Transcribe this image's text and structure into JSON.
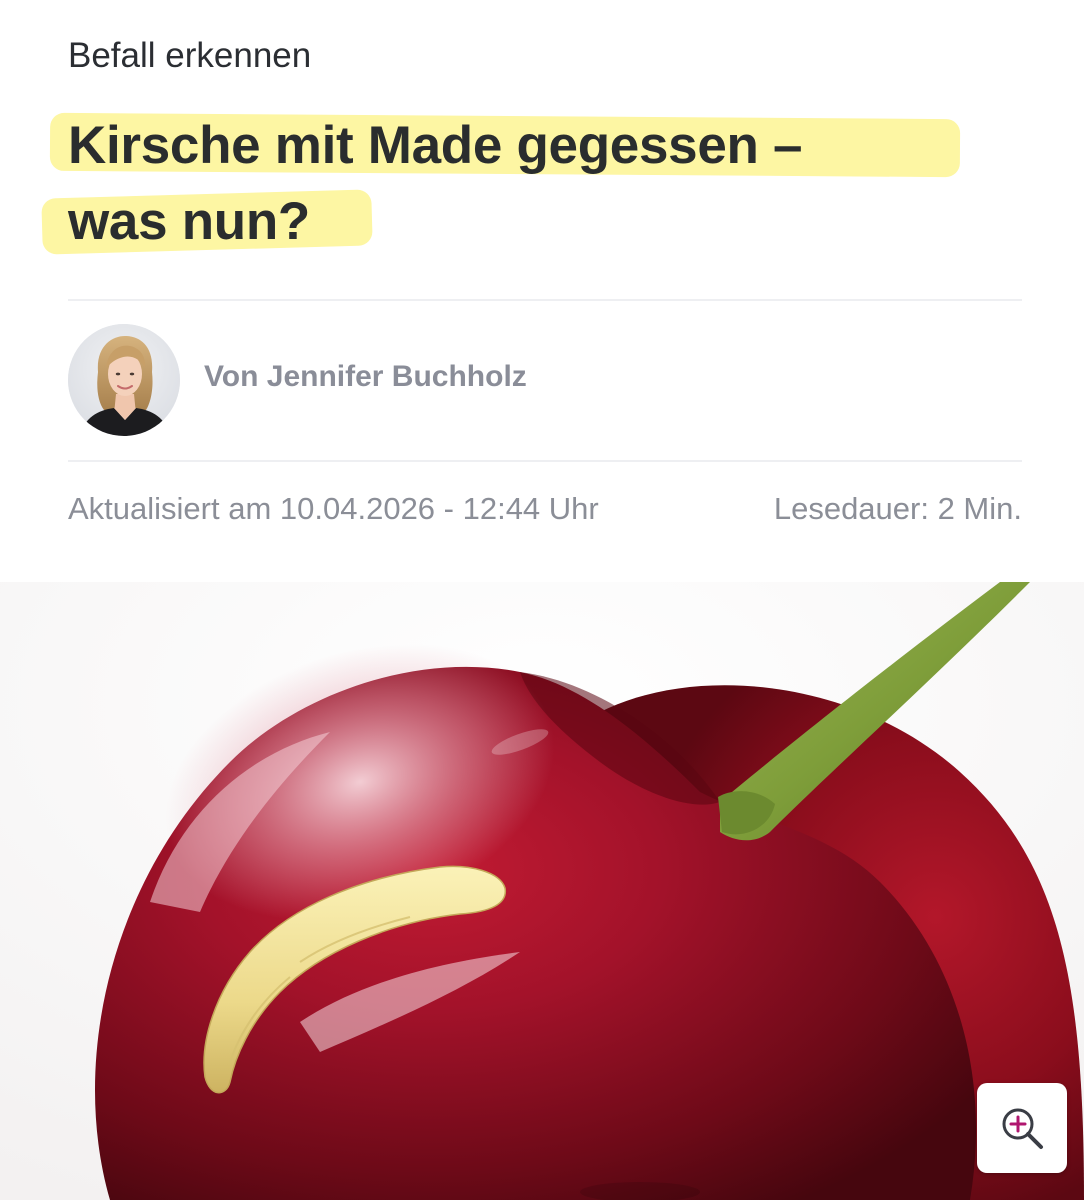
{
  "article": {
    "kicker": "Befall erkennen",
    "headline_line1": "Kirsche mit Made gegessen –",
    "headline_line2": "was nun?",
    "author": "Von Jennifer Buchholz",
    "updated": "Aktualisiert am 10.04.2026 - 12:44 Uhr",
    "reading_time": "Lesedauer: 2 Min."
  },
  "hero": {
    "subject": "cherry with maggot"
  },
  "icons": {
    "avatar": "author-portrait",
    "zoom": "zoom-in-icon"
  },
  "colors": {
    "highlight": "#fdf6a3",
    "headline": "#2a2d2e",
    "meta": "#8b8e97",
    "zoom_accent": "#b0166f"
  }
}
